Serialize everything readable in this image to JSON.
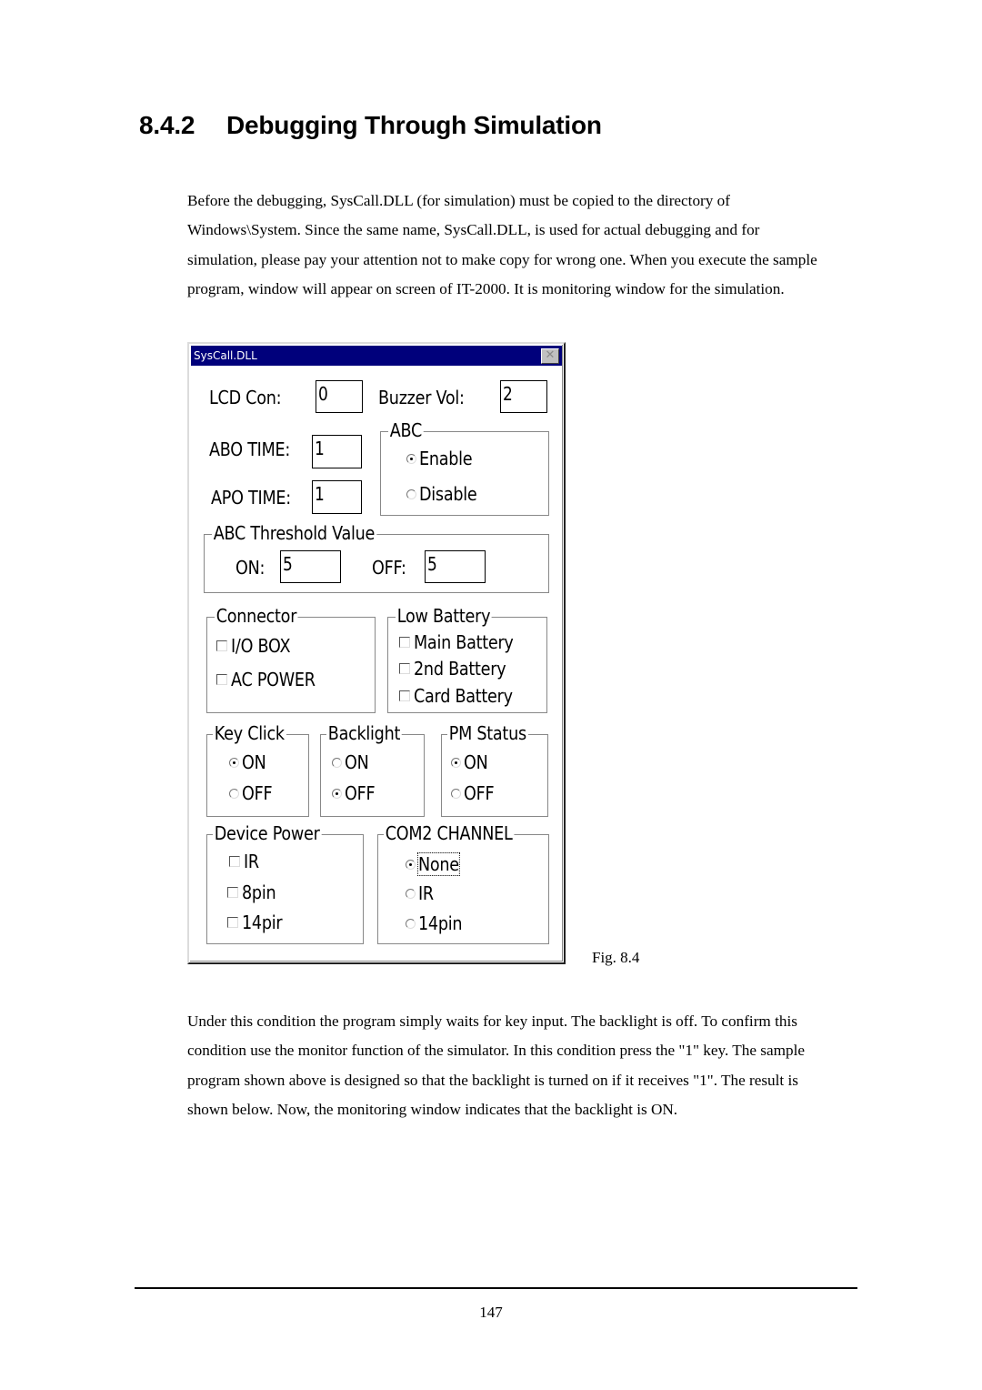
{
  "heading": {
    "number": "8.4.2",
    "title": "Debugging Through Simulation"
  },
  "intro_paragraph_lines": [
    "Before the debugging, SysCall.DLL (for simulation) must be copied to the directory of",
    "Windows\\System. Since the same name, SysCall.DLL, is used for actual debugging and for",
    "simulation, please pay your attention not to make copy for wrong one. When you execute the sample",
    "program, window will appear on screen of IT-2000. It is monitoring window for the simulation."
  ],
  "dialog": {
    "title": "SysCall.DLL",
    "close_icon": "close-x-icon",
    "lcd_con": {
      "label": "LCD Con:",
      "value": "0"
    },
    "buzzer_vol": {
      "label": "Buzzer Vol:",
      "value": "2"
    },
    "abo_time": {
      "label": "ABO TIME:",
      "value": "1"
    },
    "apo_time": {
      "label": "APO TIME:",
      "value": "1"
    },
    "abc": {
      "title": "ABC",
      "options": [
        {
          "label": "Enable",
          "selected": true
        },
        {
          "label": "Disable",
          "selected": false
        }
      ]
    },
    "abc_threshold": {
      "title": "ABC Threshold Value",
      "on_label": "ON:",
      "on_value": "5",
      "off_label": "OFF:",
      "off_value": "5"
    },
    "connector": {
      "title": "Connector",
      "items": [
        {
          "label": "I/O BOX",
          "checked": false
        },
        {
          "label": "AC POWER",
          "checked": false
        }
      ]
    },
    "low_battery": {
      "title": "Low Battery",
      "items": [
        {
          "label": "Main Battery",
          "checked": false
        },
        {
          "label": "2nd Battery",
          "checked": false
        },
        {
          "label": "Card Battery",
          "checked": false
        }
      ]
    },
    "key_click": {
      "title": "Key Click",
      "options": [
        {
          "label": "ON",
          "selected": true
        },
        {
          "label": "OFF",
          "selected": false
        }
      ]
    },
    "backlight": {
      "title": "Backlight",
      "options": [
        {
          "label": "ON",
          "selected": false
        },
        {
          "label": "OFF",
          "selected": true
        }
      ]
    },
    "pm_status": {
      "title": "PM Status",
      "options": [
        {
          "label": "ON",
          "selected": true
        },
        {
          "label": "OFF",
          "selected": false
        }
      ]
    },
    "device_power": {
      "title": "Device Power",
      "items": [
        {
          "label": "IR",
          "checked": false
        },
        {
          "label": "8pin",
          "checked": false
        },
        {
          "label": "14pir",
          "checked": false
        }
      ]
    },
    "com2_channel": {
      "title": "COM2 CHANNEL",
      "options": [
        {
          "label": "None",
          "selected": true
        },
        {
          "label": "IR",
          "selected": false
        },
        {
          "label": "14pin",
          "selected": false
        }
      ]
    }
  },
  "figure_caption": "Fig. 8.4",
  "result_paragraph_lines": [
    "Under this condition the program simply waits for key input. The backlight is off. To confirm this",
    "condition use the monitor function of the simulator. In this condition press the \"1\" key. The sample",
    "program shown above is designed so that the backlight is turned on if it receives \"1\". The result is",
    "shown below. Now, the monitoring window indicates that the backlight is ON."
  ],
  "page_number": "147"
}
